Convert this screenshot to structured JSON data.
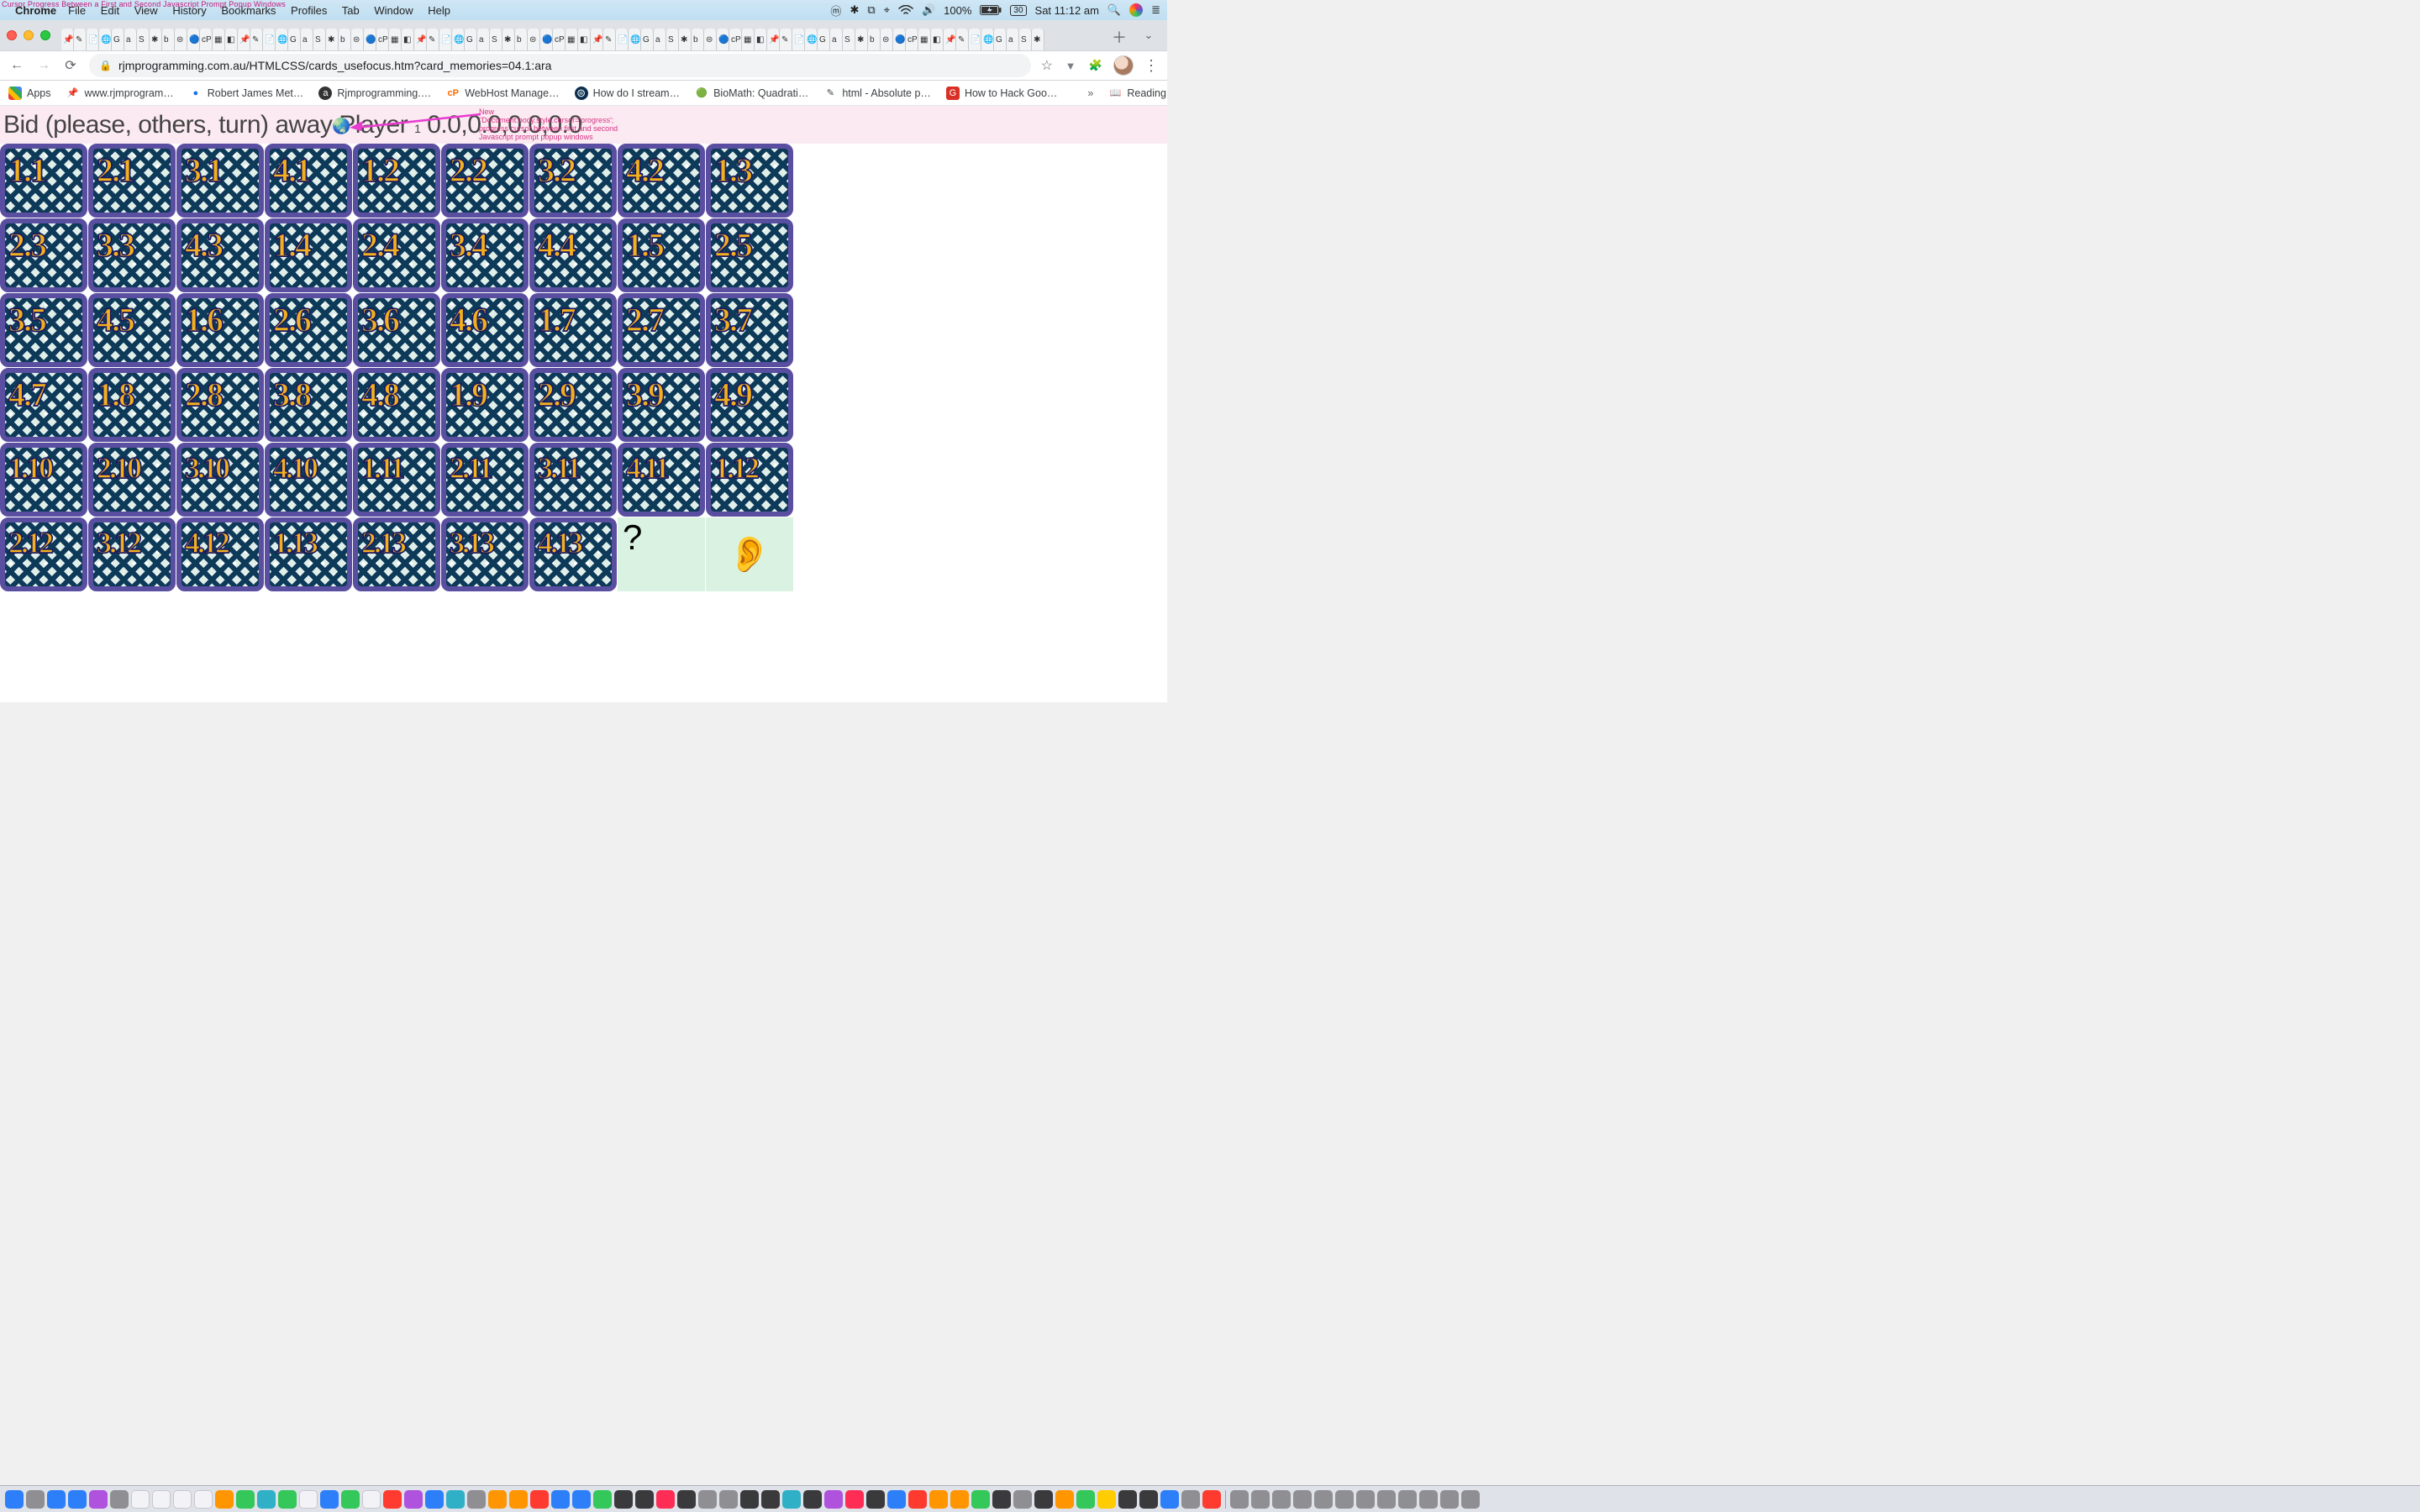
{
  "menubar": {
    "overlay": "Cursor Progress Between a First and Second Javascript Prompt Popup Windows",
    "app": "Chrome",
    "items": [
      "File",
      "Edit",
      "View",
      "History",
      "Bookmarks",
      "Profiles",
      "Tab",
      "Window",
      "Help"
    ],
    "battery": "100%",
    "clock": "Sat 11:12 am",
    "date_badge": "30"
  },
  "toolbar": {
    "url": "rjmprogramming.com.au/HTMLCSS/cards_usefocus.htm?card_memories=04.1:ara"
  },
  "bookmarks": {
    "items": [
      {
        "icon": "⠿",
        "label": "Apps",
        "color": ""
      },
      {
        "icon": "📌",
        "label": "www.rjmprogram…",
        "color": ""
      },
      {
        "icon": "🔵",
        "label": "Robert James Met…",
        "color": "#1a73e8"
      },
      {
        "icon": "ⓐ",
        "label": "Rjmprogramming.…",
        "color": "#333"
      },
      {
        "icon": "cP",
        "label": "WebHost Manage…",
        "color": "#ff6a00"
      },
      {
        "icon": "⚙",
        "label": "How do I stream…",
        "color": "#0b2e4f"
      },
      {
        "icon": "S",
        "label": "BioMath: Quadrati…",
        "color": "#2e7d32"
      },
      {
        "icon": "✎",
        "label": "html - Absolute p…",
        "color": ""
      },
      {
        "icon": "G",
        "label": "How to Hack Goo…",
        "color": "#d93025"
      }
    ],
    "reading": "Reading List"
  },
  "page": {
    "title_a": "Bid (please, others, turn) away Player",
    "title_sub": "1",
    "title_b": "0.0,0.0,0.0,0.0",
    "globe": "🌏",
    "annotation": "New\n\"Document.body.style.cursor='progress';\nprogress cursor between first and second\nJavascript prompt popup windows",
    "qmark": "?",
    "ear": "👂"
  },
  "cards": [
    [
      "1.1",
      "2.1",
      "3.1",
      "4.1",
      "1.2",
      "2.2",
      "3.2",
      "4.2",
      "1.3"
    ],
    [
      "2.3",
      "3.3",
      "4.3",
      "1.4",
      "2.4",
      "3.4",
      "4.4",
      "1.5",
      "2.5"
    ],
    [
      "3.5",
      "4.5",
      "1.6",
      "2.6",
      "3.6",
      "4.6",
      "1.7",
      "2.7",
      "3.7"
    ],
    [
      "4.7",
      "1.8",
      "2.8",
      "3.8",
      "4.8",
      "1.9",
      "2.9",
      "3.9",
      "4.9"
    ],
    [
      "1.10",
      "2.10",
      "3.10",
      "4.10",
      "1.11",
      "2.11",
      "3.11",
      "4.11",
      "1.12"
    ],
    [
      "2.12",
      "3.12",
      "4.12",
      "1.13",
      "2.13",
      "3.13",
      "4.13"
    ]
  ],
  "tab_count": 78,
  "dock_count": 70
}
